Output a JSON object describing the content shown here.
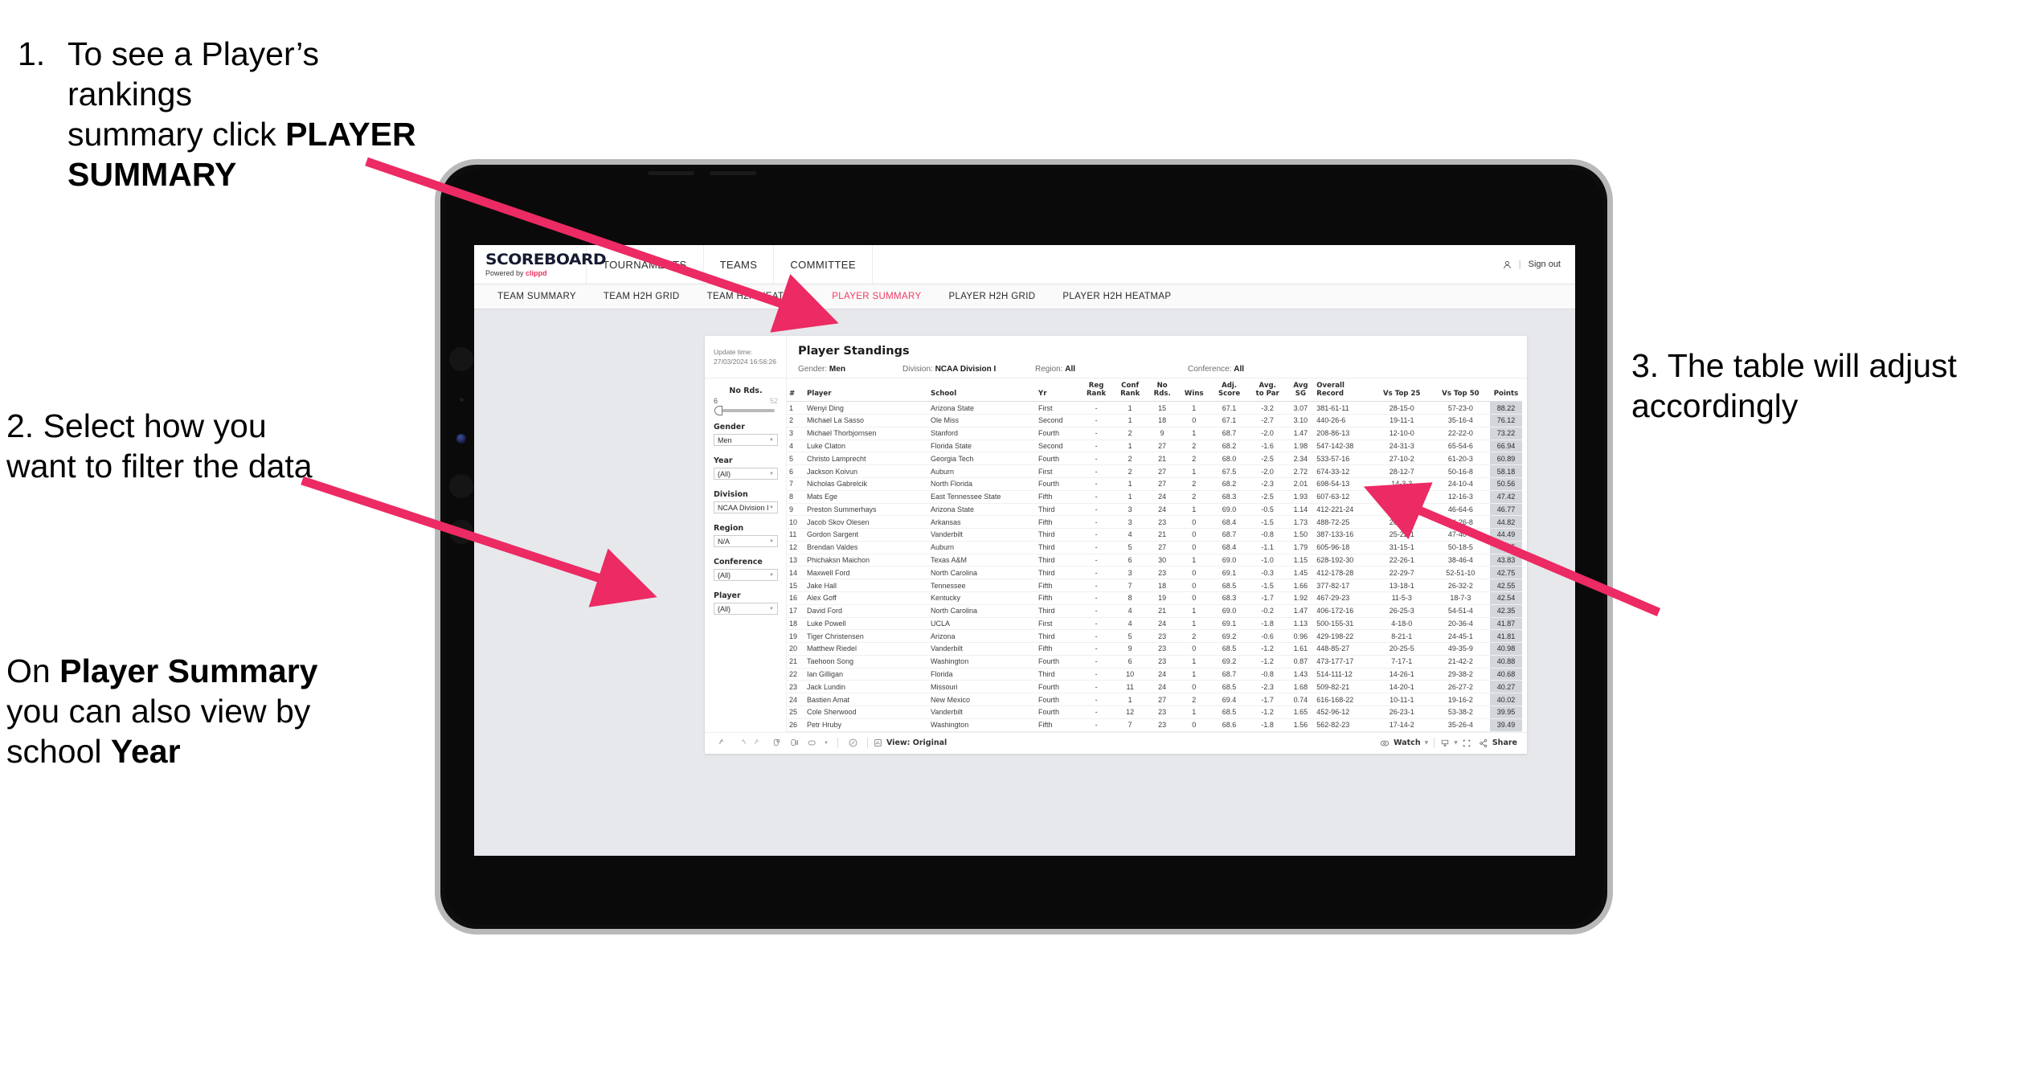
{
  "annotations": {
    "a1_number": "1.",
    "a1_line1": "To see a Player’s rankings",
    "a1_line2_pre": "summary click ",
    "a1_line2_bold": "PLAYER SUMMARY",
    "a2_text": "2. Select how you want to filter the data",
    "a3_pre": "On ",
    "a3_bold1": "Player Summary",
    "a3_mid": " you can also view by school ",
    "a3_bold2": "Year",
    "a4_text": "3. The table will adjust accordingly"
  },
  "app": {
    "logo_main": "SCOREBOARD",
    "logo_sub_pre": "Powered by ",
    "logo_sub_brand": "clippd",
    "nav": [
      "TOURNAMENTS",
      "TEAMS",
      "COMMITTEE"
    ],
    "account_icon": "person-icon",
    "divider": "|",
    "sign_out": "Sign out",
    "tabs": [
      {
        "label": "TEAM SUMMARY",
        "active": false
      },
      {
        "label": "TEAM H2H GRID",
        "active": false
      },
      {
        "label": "TEAM H2H HEATMAP",
        "active": false
      },
      {
        "label": "PLAYER SUMMARY",
        "active": true
      },
      {
        "label": "PLAYER H2H GRID",
        "active": false
      },
      {
        "label": "PLAYER H2H HEATMAP",
        "active": false
      }
    ],
    "accent_color": "#f03a63"
  },
  "viz": {
    "update_label": "Update time:",
    "update_value": "27/03/2024 16:56:26",
    "title": "Player Standings",
    "meta": [
      {
        "label": "Gender: ",
        "value": "Men"
      },
      {
        "label": "Division: ",
        "value": "NCAA Division I"
      },
      {
        "label": "Region: ",
        "value": "All"
      },
      {
        "label": "Conference: ",
        "value": "All"
      }
    ],
    "filters": {
      "slider": {
        "label": "No Rds.",
        "min": "6",
        "max": "52"
      },
      "selects": [
        {
          "label": "Gender",
          "value": "Men"
        },
        {
          "label": "Year",
          "value": "(All)"
        },
        {
          "label": "Division",
          "value": "NCAA Division I"
        },
        {
          "label": "Region",
          "value": "N/A"
        },
        {
          "label": "Conference",
          "value": "(All)"
        },
        {
          "label": "Player",
          "value": "(All)"
        }
      ]
    },
    "toolbar": {
      "undo_icon": "undo-icon",
      "redo_icon": "redo-icon",
      "revert_icon": "revert-icon",
      "refresh_icon": "refresh-data-icon",
      "pause_icon": "pause-updates-icon",
      "rectangle_select_icon": "rectangle-select-icon",
      "dropdown_icon": "chevron-down-icon",
      "highlight_icon": "highlight-icon",
      "view_icon": "view-icon",
      "view_label": "View: Original",
      "watch_icon": "eye-icon",
      "watch_label": "Watch",
      "download_icon": "download-icon",
      "fullscreen_icon": "fullscreen-icon",
      "share_icon": "share-icon",
      "share_label": "Share"
    }
  },
  "chart_data": {
    "type": "table",
    "title": "Player Standings",
    "columns": [
      "#",
      "Player",
      "School",
      "Yr",
      "Reg\nRank",
      "Conf\nRank",
      "No\nRds.",
      "Wins",
      "Adj.\nScore",
      "Avg.\nto Par",
      "Avg\nSG",
      "Overall\nRecord",
      "Vs Top 25",
      "Vs Top 50",
      "Points"
    ],
    "rows": [
      [
        "1",
        "Wenyi Ding",
        "Arizona State",
        "First",
        "-",
        "1",
        "15",
        "1",
        "67.1",
        "-3.2",
        "3.07",
        "381-61-11",
        "28-15-0",
        "57-23-0",
        "88.22"
      ],
      [
        "2",
        "Michael La Sasso",
        "Ole Miss",
        "Second",
        "-",
        "1",
        "18",
        "0",
        "67.1",
        "-2.7",
        "3.10",
        "440-26-6",
        "19-11-1",
        "35-16-4",
        "76.12"
      ],
      [
        "3",
        "Michael Thorbjornsen",
        "Stanford",
        "Fourth",
        "-",
        "2",
        "9",
        "1",
        "68.7",
        "-2.0",
        "1.47",
        "208-86-13",
        "12-10-0",
        "22-22-0",
        "73.22"
      ],
      [
        "4",
        "Luke Claton",
        "Florida State",
        "Second",
        "-",
        "1",
        "27",
        "2",
        "68.2",
        "-1.6",
        "1.98",
        "547-142-38",
        "24-31-3",
        "65-54-6",
        "66.94"
      ],
      [
        "5",
        "Christo Lamprecht",
        "Georgia Tech",
        "Fourth",
        "-",
        "2",
        "21",
        "2",
        "68.0",
        "-2.5",
        "2.34",
        "533-57-16",
        "27-10-2",
        "61-20-3",
        "60.89"
      ],
      [
        "6",
        "Jackson Koivun",
        "Auburn",
        "First",
        "-",
        "2",
        "27",
        "1",
        "67.5",
        "-2.0",
        "2.72",
        "674-33-12",
        "28-12-7",
        "50-16-8",
        "58.18"
      ],
      [
        "7",
        "Nicholas Gabrelcik",
        "North Florida",
        "Fourth",
        "-",
        "1",
        "27",
        "2",
        "68.2",
        "-2.3",
        "2.01",
        "698-54-13",
        "14-3-3",
        "24-10-4",
        "50.56"
      ],
      [
        "8",
        "Mats Ege",
        "East Tennessee State",
        "Fifth",
        "-",
        "1",
        "24",
        "2",
        "68.3",
        "-2.5",
        "1.93",
        "607-63-12",
        "8-6-1",
        "12-16-3",
        "47.42"
      ],
      [
        "9",
        "Preston Summerhays",
        "Arizona State",
        "Third",
        "-",
        "3",
        "24",
        "1",
        "69.0",
        "-0.5",
        "1.14",
        "412-221-24",
        "19-39-2",
        "46-64-6",
        "46.77"
      ],
      [
        "10",
        "Jacob Skov Olesen",
        "Arkansas",
        "Fifth",
        "-",
        "3",
        "23",
        "0",
        "68.4",
        "-1.5",
        "1.73",
        "488-72-25",
        "20-14-5",
        "44-26-8",
        "44.82"
      ],
      [
        "11",
        "Gordon Sargent",
        "Vanderbilt",
        "Third",
        "-",
        "4",
        "21",
        "0",
        "68.7",
        "-0.8",
        "1.50",
        "387-133-16",
        "25-22-1",
        "47-40-3",
        "44.49"
      ],
      [
        "12",
        "Brendan Valdes",
        "Auburn",
        "Third",
        "-",
        "5",
        "27",
        "0",
        "68.4",
        "-1.1",
        "1.79",
        "605-96-18",
        "31-15-1",
        "50-18-5",
        "43.95"
      ],
      [
        "13",
        "Phichaksn Maichon",
        "Texas A&M",
        "Third",
        "-",
        "6",
        "30",
        "1",
        "69.0",
        "-1.0",
        "1.15",
        "628-192-30",
        "22-26-1",
        "38-46-4",
        "43.83"
      ],
      [
        "14",
        "Maxwell Ford",
        "North Carolina",
        "Third",
        "-",
        "3",
        "23",
        "0",
        "69.1",
        "-0.3",
        "1.45",
        "412-178-28",
        "22-29-7",
        "52-51-10",
        "42.75"
      ],
      [
        "15",
        "Jake Hall",
        "Tennessee",
        "Fifth",
        "-",
        "7",
        "18",
        "0",
        "68.5",
        "-1.5",
        "1.66",
        "377-82-17",
        "13-18-1",
        "26-32-2",
        "42.55"
      ],
      [
        "16",
        "Alex Goff",
        "Kentucky",
        "Fifth",
        "-",
        "8",
        "19",
        "0",
        "68.3",
        "-1.7",
        "1.92",
        "467-29-23",
        "11-5-3",
        "18-7-3",
        "42.54"
      ],
      [
        "17",
        "David Ford",
        "North Carolina",
        "Third",
        "-",
        "4",
        "21",
        "1",
        "69.0",
        "-0.2",
        "1.47",
        "406-172-16",
        "26-25-3",
        "54-51-4",
        "42.35"
      ],
      [
        "18",
        "Luke Powell",
        "UCLA",
        "First",
        "-",
        "4",
        "24",
        "1",
        "69.1",
        "-1.8",
        "1.13",
        "500-155-31",
        "4-18-0",
        "20-36-4",
        "41.87"
      ],
      [
        "19",
        "Tiger Christensen",
        "Arizona",
        "Third",
        "-",
        "5",
        "23",
        "2",
        "69.2",
        "-0.6",
        "0.96",
        "429-198-22",
        "8-21-1",
        "24-45-1",
        "41.81"
      ],
      [
        "20",
        "Matthew Riedel",
        "Vanderbilt",
        "Fifth",
        "-",
        "9",
        "23",
        "0",
        "68.5",
        "-1.2",
        "1.61",
        "448-85-27",
        "20-25-5",
        "49-35-9",
        "40.98"
      ],
      [
        "21",
        "Taehoon Song",
        "Washington",
        "Fourth",
        "-",
        "6",
        "23",
        "1",
        "69.2",
        "-1.2",
        "0.87",
        "473-177-17",
        "7-17-1",
        "21-42-2",
        "40.88"
      ],
      [
        "22",
        "Ian Gilligan",
        "Florida",
        "Third",
        "-",
        "10",
        "24",
        "1",
        "68.7",
        "-0.8",
        "1.43",
        "514-111-12",
        "14-26-1",
        "29-38-2",
        "40.68"
      ],
      [
        "23",
        "Jack Lundin",
        "Missouri",
        "Fourth",
        "-",
        "11",
        "24",
        "0",
        "68.5",
        "-2.3",
        "1.68",
        "509-82-21",
        "14-20-1",
        "26-27-2",
        "40.27"
      ],
      [
        "24",
        "Bastien Amat",
        "New Mexico",
        "Fourth",
        "-",
        "1",
        "27",
        "2",
        "69.4",
        "-1.7",
        "0.74",
        "616-168-22",
        "10-11-1",
        "19-16-2",
        "40.02"
      ],
      [
        "25",
        "Cole Sherwood",
        "Vanderbilt",
        "Fourth",
        "-",
        "12",
        "23",
        "1",
        "68.5",
        "-1.2",
        "1.65",
        "452-96-12",
        "26-23-1",
        "53-38-2",
        "39.95"
      ],
      [
        "26",
        "Petr Hruby",
        "Washington",
        "Fifth",
        "-",
        "7",
        "23",
        "0",
        "68.6",
        "-1.8",
        "1.56",
        "562-82-23",
        "17-14-2",
        "35-26-4",
        "39.49"
      ]
    ],
    "highlight_column": "Points",
    "highlight_color": "#d3d6da"
  }
}
